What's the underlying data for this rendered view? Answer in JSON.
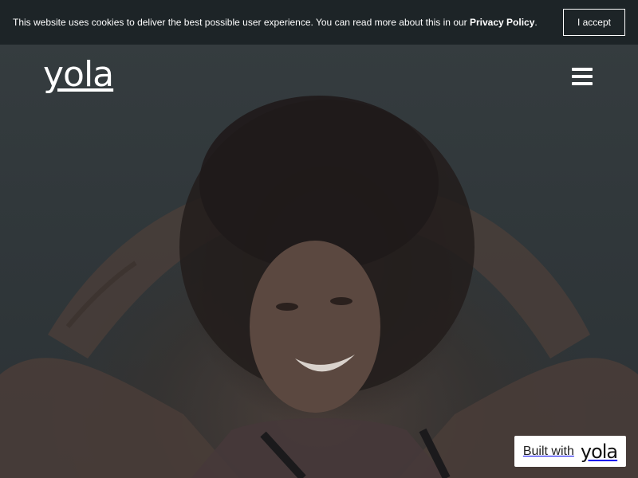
{
  "cookie_bar": {
    "message": "This website uses cookies to deliver the best possible user experience. You can read more about this in our ",
    "link_label": "Privacy Policy",
    "suffix": ".",
    "accept_label": "I accept"
  },
  "header": {
    "logo_text": "yola",
    "menu_icon": "hamburger-menu-icon"
  },
  "hero": {
    "image": "smiling woman with curly hair, hands behind head"
  },
  "badge": {
    "label": "Built with",
    "logo_text": "yola"
  },
  "colors": {
    "cookie_bar_bg": "#1d2427",
    "hero_overlay": "#2f3538",
    "text": "#ffffff"
  }
}
